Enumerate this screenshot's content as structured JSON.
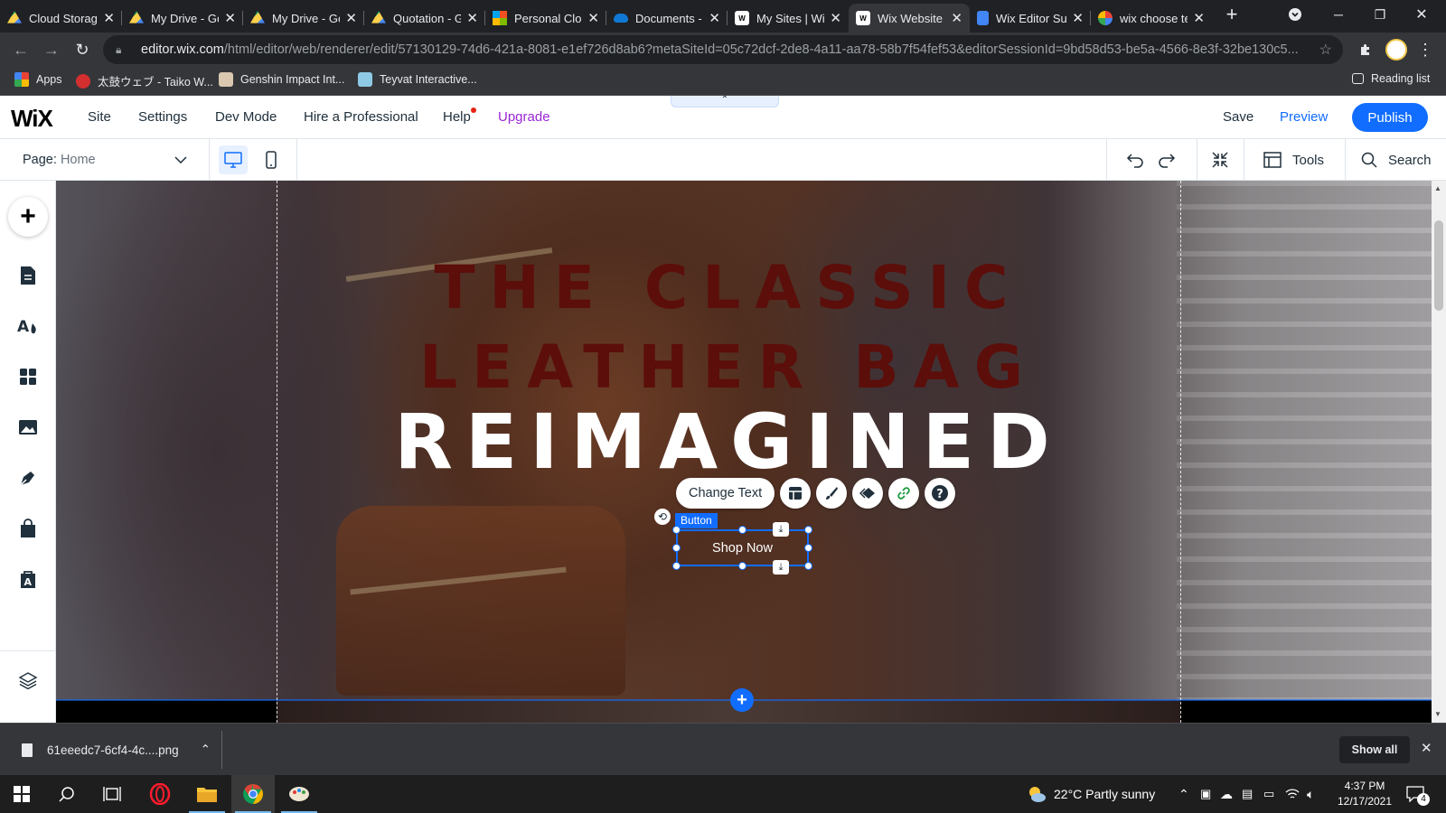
{
  "browser": {
    "tabs": [
      {
        "title": "Cloud Storage",
        "favicon": "google-drive-icon"
      },
      {
        "title": "My Drive - Google Drive",
        "favicon": "google-drive-icon"
      },
      {
        "title": "My Drive - Google Drive",
        "favicon": "google-drive-icon"
      },
      {
        "title": "Quotation - Google Drive",
        "favicon": "google-drive-icon"
      },
      {
        "title": "Personal Cloud Storage",
        "favicon": "microsoft-icon"
      },
      {
        "title": "Documents - OneDrive",
        "favicon": "onedrive-icon"
      },
      {
        "title": "My Sites | Wix",
        "favicon": "wix-icon"
      },
      {
        "title": "Wix Website Editor",
        "favicon": "wix-icon",
        "active": true
      },
      {
        "title": "Wix Editor Support",
        "favicon": "google-docs-icon"
      },
      {
        "title": "wix choose template",
        "favicon": "google-icon"
      }
    ],
    "url_host": "editor.wix.com",
    "url_path": "/html/editor/web/renderer/edit/57130129-74d6-421a-8081-e1ef726d8ab6?metaSiteId=05c72dcf-2de8-4a11-aa78-58b7f54fef53&editorSessionId=9bd58d53-be5a-4566-8e3f-32be130c5...",
    "bookmarks": [
      {
        "label": "Apps",
        "icon": "apps-grid-icon"
      },
      {
        "label": "太鼓ウェブ - Taiko W...",
        "icon": "taiko-icon"
      },
      {
        "label": "Genshin Impact Int...",
        "icon": "genshin-icon"
      },
      {
        "label": "Teyvat Interactive...",
        "icon": "teyvat-icon"
      }
    ],
    "reading_list": "Reading list"
  },
  "wix": {
    "logo": "WiX",
    "menu": [
      "Site",
      "Settings",
      "Dev Mode",
      "Hire a Professional",
      "Help",
      "Upgrade"
    ],
    "save": "Save",
    "preview": "Preview",
    "publish": "Publish",
    "page_label": "Page:",
    "page_name": "Home",
    "tools": "Tools",
    "search": "Search"
  },
  "canvas": {
    "headline1": "THE CLASSIC",
    "headline2": "LEATHER BAG",
    "headline3": "REIMAGINED",
    "change_text": "Change Text",
    "selection_label": "Button",
    "button_text": "Shop Now"
  },
  "downloads": {
    "filename": "61eeedc7-6cf4-4c....png",
    "show_all": "Show all"
  },
  "taskbar": {
    "weather_temp": "22°C",
    "weather_text": "Partly sunny",
    "time": "4:37 PM",
    "date": "12/17/2021",
    "notifications": "4"
  },
  "colors": {
    "wix_blue": "#116dff",
    "upgrade_purple": "#9a27d5",
    "headline_maroon": "#5c0e0a"
  }
}
